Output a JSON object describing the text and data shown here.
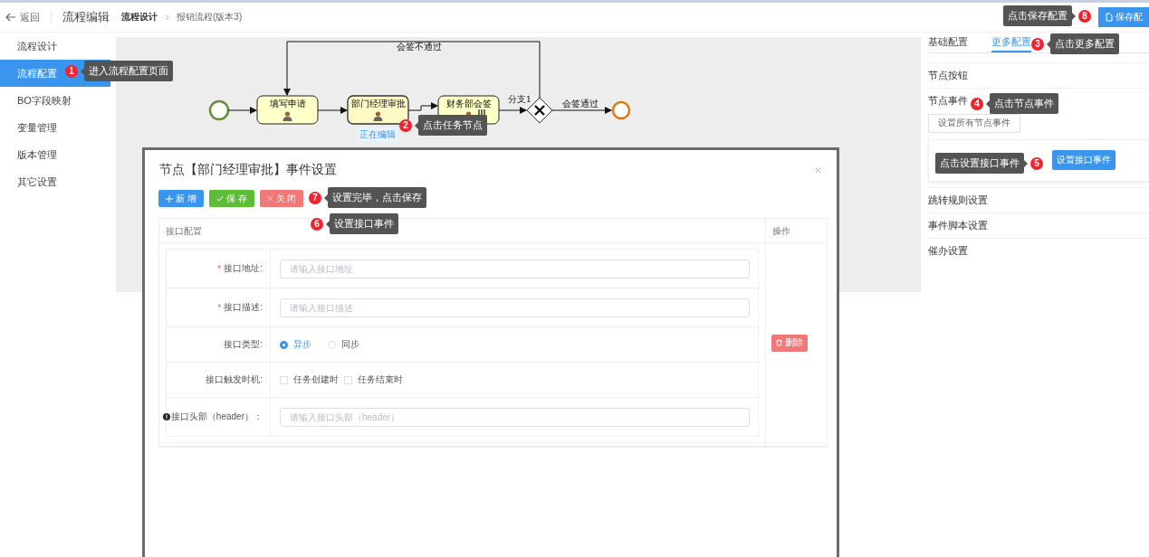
{
  "top_bar": {
    "back": "返回",
    "title": "流程编辑",
    "breadcrumb": [
      "流程设计",
      "报销流程(版本3)"
    ],
    "save_button": "保存配"
  },
  "sidebar": {
    "items": [
      {
        "label": "流程设计",
        "selected": false
      },
      {
        "label": "流程配置",
        "selected": true
      },
      {
        "label": "BO字段映射",
        "selected": false
      },
      {
        "label": "变量管理",
        "selected": false
      },
      {
        "label": "版本管理",
        "selected": false
      },
      {
        "label": "其它设置",
        "selected": false
      }
    ]
  },
  "diagram": {
    "tasks": [
      {
        "label": "填写申请",
        "editing": false,
        "multi_instance": false
      },
      {
        "label": "部门经理审批",
        "editing": true,
        "multi_instance": false
      },
      {
        "label": "财务部会签",
        "editing": false,
        "multi_instance": true
      }
    ],
    "editing_badge": "正在编辑",
    "gateway_label": "分支1",
    "reject_label": "会签不通过",
    "pass_label": "会签通过"
  },
  "right_panel": {
    "tabs": [
      {
        "label": "基础配置",
        "selected": false
      },
      {
        "label": "更多配置",
        "selected": true
      }
    ],
    "sections": [
      {
        "label": "节点按钮",
        "kind": "plain"
      },
      {
        "label": "节点事件",
        "kind": "events",
        "all_events_button": "设置所有节点事件",
        "interface_button": "设置接口事件"
      },
      {
        "label": "跳转规则设置",
        "kind": "plain"
      },
      {
        "label": "事件脚本设置",
        "kind": "plain"
      },
      {
        "label": "催办设置",
        "kind": "plain"
      }
    ]
  },
  "dialog": {
    "title": "节点【部门经理审批】事件设置",
    "buttons": [
      {
        "label": "新 增",
        "kind": "add"
      },
      {
        "label": "保 存",
        "kind": "save"
      },
      {
        "label": "关 闭",
        "kind": "close"
      }
    ],
    "columns": [
      "接口配置",
      "操作"
    ],
    "rows": [
      {
        "label": "接口地址:",
        "required": true,
        "kind": "input",
        "placeholder": "请输入接口地址"
      },
      {
        "label": "接口描述:",
        "required": true,
        "kind": "input",
        "placeholder": "请输入接口描述"
      },
      {
        "label": "接口类型:",
        "required": false,
        "kind": "radio",
        "options": [
          {
            "label": "异步",
            "selected": true
          },
          {
            "label": "同步",
            "selected": false
          }
        ]
      },
      {
        "label": "接口触发时机:",
        "required": false,
        "kind": "checkbox",
        "options": [
          {
            "label": "任务创建时",
            "checked": false
          },
          {
            "label": "任务结束时",
            "checked": false
          }
        ]
      },
      {
        "label": "接口头部（header）：",
        "required": false,
        "kind": "input",
        "info": true,
        "placeholder": "请输入接口头部（header）"
      }
    ],
    "required_mark": "*",
    "delete_button": "删除"
  },
  "guides": [
    {
      "number": "8",
      "text": "点击保存配置"
    },
    {
      "number": "3",
      "text": "点击更多配置"
    },
    {
      "number": "1",
      "text": "进入流程配置页面"
    },
    {
      "number": "4",
      "text": "点击节点事件"
    },
    {
      "number": "2",
      "text": "点击任务节点"
    },
    {
      "number": "5",
      "text": "点击设置接口事件"
    },
    {
      "number": "7",
      "text": "设置完毕，点击保存"
    },
    {
      "number": "6",
      "text": "设置接口事件"
    }
  ]
}
